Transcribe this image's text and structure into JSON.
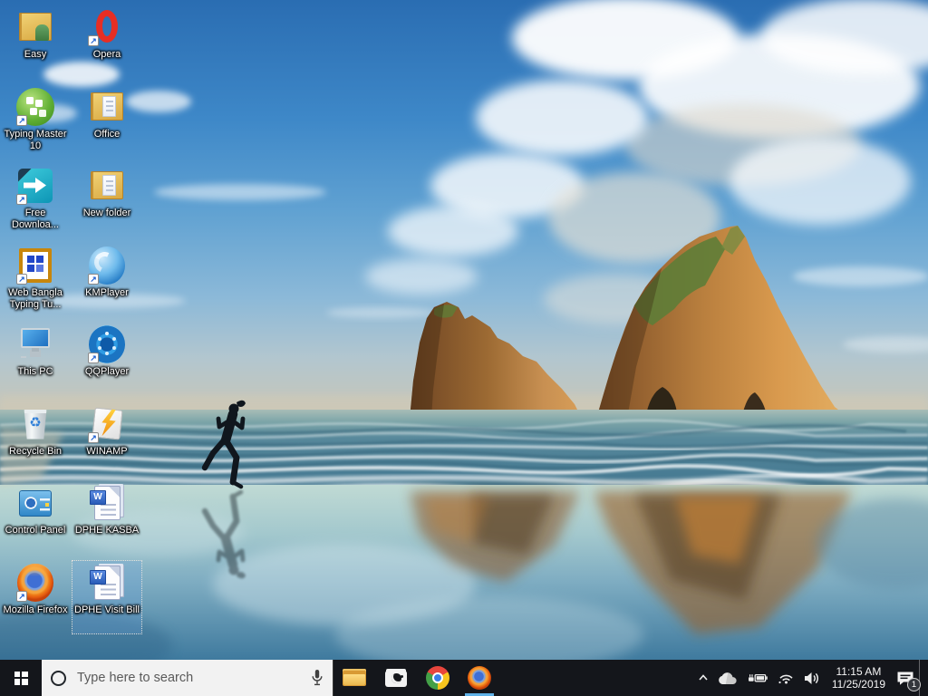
{
  "desktop": {
    "icons": [
      {
        "label": "Easy",
        "icon": "folder-user",
        "col": 1,
        "row": 1,
        "shortcut": false,
        "selected": false
      },
      {
        "label": "Opera",
        "icon": "opera",
        "col": 2,
        "row": 1,
        "shortcut": true,
        "selected": false
      },
      {
        "label": "Typing Master 10",
        "icon": "typing-master",
        "col": 1,
        "row": 2,
        "shortcut": true,
        "selected": false
      },
      {
        "label": "Office",
        "icon": "folder-docs",
        "col": 2,
        "row": 2,
        "shortcut": false,
        "selected": false
      },
      {
        "label": "Free Downloa...",
        "icon": "fdm",
        "col": 1,
        "row": 3,
        "shortcut": true,
        "selected": false
      },
      {
        "label": "New folder",
        "icon": "folder-docs",
        "col": 2,
        "row": 3,
        "shortcut": false,
        "selected": false
      },
      {
        "label": "Web Bangla Typing Tu...",
        "icon": "web-bangla",
        "col": 1,
        "row": 4,
        "shortcut": true,
        "selected": false
      },
      {
        "label": "KMPlayer",
        "icon": "kmplayer",
        "col": 2,
        "row": 4,
        "shortcut": true,
        "selected": false
      },
      {
        "label": "This PC",
        "icon": "this-pc",
        "col": 1,
        "row": 5,
        "shortcut": false,
        "selected": false
      },
      {
        "label": "QQPlayer",
        "icon": "qqplayer",
        "col": 2,
        "row": 5,
        "shortcut": true,
        "selected": false
      },
      {
        "label": "Recycle Bin",
        "icon": "recycle-bin",
        "col": 1,
        "row": 6,
        "shortcut": false,
        "selected": false
      },
      {
        "label": "WINAMP",
        "icon": "winamp",
        "col": 2,
        "row": 6,
        "shortcut": true,
        "selected": false
      },
      {
        "label": "Control Panel",
        "icon": "control-panel",
        "col": 1,
        "row": 7,
        "shortcut": false,
        "selected": false
      },
      {
        "label": "DPHE KASBA",
        "icon": "word-doc",
        "col": 2,
        "row": 7,
        "shortcut": false,
        "selected": false
      },
      {
        "label": "Mozilla Firefox",
        "icon": "firefox",
        "col": 1,
        "row": 8,
        "shortcut": true,
        "selected": false
      },
      {
        "label": "DPHE Visit Bill",
        "icon": "word-doc",
        "col": 2,
        "row": 8,
        "shortcut": false,
        "selected": true
      }
    ]
  },
  "wallpaper": {
    "scene": "beach with two archway rock islands and a running woman silhouette reflected on wet sand",
    "colors": {
      "sky_top": "#2a6db2",
      "sky_horizon": "#cdc6b2",
      "sea": "#4a7d95",
      "sand_reflection": "#9a5e28",
      "rock": "#c98f4e"
    }
  },
  "taskbar": {
    "start_label": "start-menu",
    "search": {
      "placeholder": "Type here to search"
    },
    "apps": [
      {
        "name": "file-explorer",
        "running": false
      },
      {
        "name": "camera",
        "running": false
      },
      {
        "name": "chrome",
        "running": false
      },
      {
        "name": "firefox",
        "running": true
      }
    ],
    "tray": {
      "icons": [
        "chevron-up",
        "onedrive-cloud",
        "battery-charging",
        "wifi",
        "volume"
      ],
      "clock": {
        "time": "11:15 AM",
        "date": "11/25/2019"
      },
      "notification_badge": "1"
    },
    "colors": {
      "taskbar_bg": "#14161b",
      "running_indicator": "#5fb2e8",
      "search_bg": "#f2f2f2"
    }
  }
}
